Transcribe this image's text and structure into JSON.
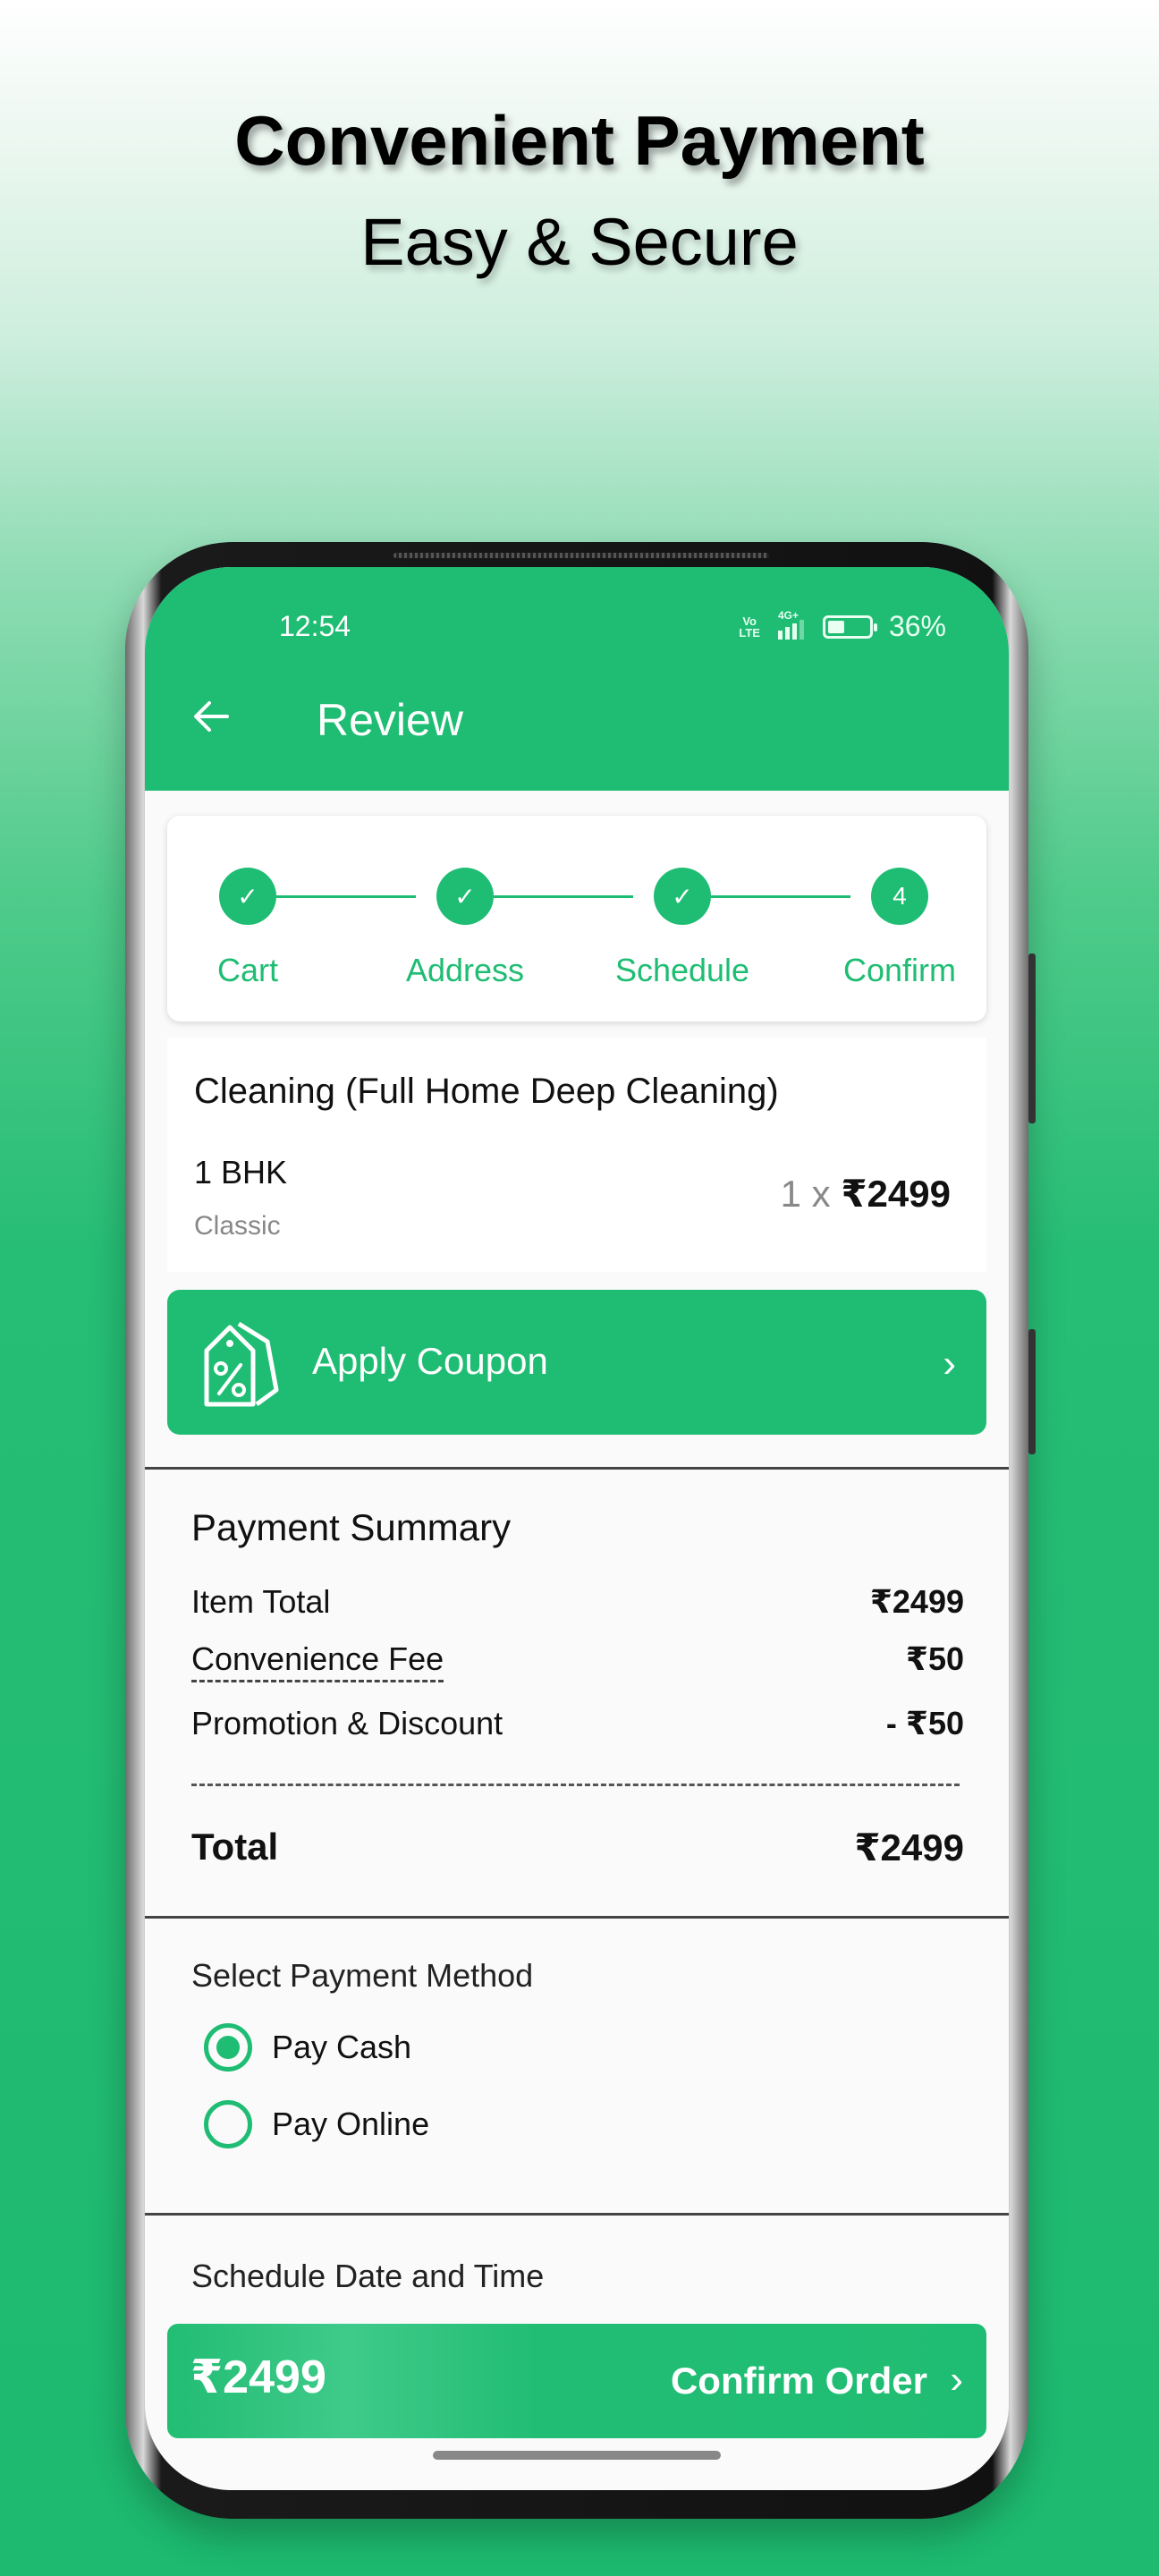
{
  "hero": {
    "title": "Convenient Payment",
    "subtitle": "Easy & Secure"
  },
  "colors": {
    "brand_green": "#1fbd73",
    "text_dark": "#111111",
    "text_muted": "#888888"
  },
  "status_bar": {
    "time": "12:54",
    "volte": "Vo LTE",
    "network": "4G+",
    "battery_percent": "36%",
    "battery_level": 0.36
  },
  "app_bar": {
    "back_icon": "arrow-left-icon",
    "title": "Review"
  },
  "stepper": {
    "steps": [
      {
        "label": "Cart",
        "state": "done",
        "marker": "✓"
      },
      {
        "label": "Address",
        "state": "done",
        "marker": "✓"
      },
      {
        "label": "Schedule",
        "state": "done",
        "marker": "✓"
      },
      {
        "label": "Confirm",
        "state": "current",
        "marker": "4"
      }
    ]
  },
  "item": {
    "title": "Cleaning (Full Home Deep Cleaning)",
    "variant": "1 BHK",
    "tier": "Classic",
    "quantity": "1 x",
    "price": "₹2499"
  },
  "coupon": {
    "icon": "percent-tag-icon",
    "label": "Apply Coupon",
    "chevron": "›"
  },
  "payment_summary": {
    "title": "Payment Summary",
    "rows": [
      {
        "label": "Item Total",
        "value": "₹2499"
      },
      {
        "label": "Convenience Fee",
        "value": "₹50"
      },
      {
        "label": "Promotion & Discount",
        "value": "- ₹50"
      }
    ],
    "total_label": "Total",
    "total_value": "₹2499"
  },
  "payment_method": {
    "title": "Select Payment Method",
    "options": [
      {
        "label": "Pay Cash",
        "selected": true
      },
      {
        "label": "Pay Online",
        "selected": false
      }
    ]
  },
  "schedule": {
    "title": "Schedule Date and Time"
  },
  "confirm_bar": {
    "amount": "₹2499",
    "label": "Confirm Order",
    "chevron": "›"
  }
}
